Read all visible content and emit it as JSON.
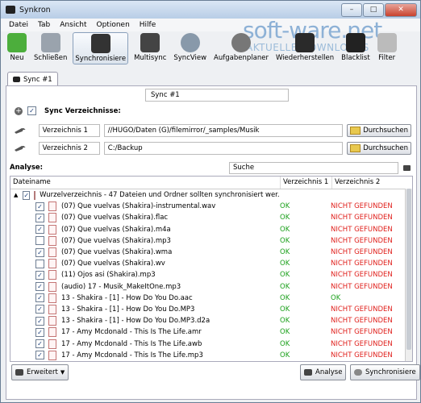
{
  "window": {
    "title": "Synkron",
    "controls": [
      "–",
      "□",
      "✕"
    ]
  },
  "watermark": {
    "main": "soft-ware.net",
    "sub": "AKTUELLE DOWNLOADS"
  },
  "menu": [
    "Datei",
    "Tab",
    "Ansicht",
    "Optionen",
    "Hilfe"
  ],
  "toolbar": [
    {
      "label": "Neu",
      "icon": "new-icon",
      "color": "#4cae3c"
    },
    {
      "label": "Schließen",
      "icon": "close-tab-icon",
      "color": "#9aa3ad"
    },
    {
      "label": "Synchronisiere",
      "icon": "sync-icon",
      "color": "#333333"
    },
    {
      "label": "Multisync",
      "icon": "multisync-icon",
      "color": "#444444"
    },
    {
      "label": "SyncView",
      "icon": "magnifier-icon",
      "color": "#8899aa"
    },
    {
      "label": "Aufgabenplaner",
      "icon": "alarm-clock-icon",
      "color": "#777777"
    },
    {
      "label": "Wiederherstellen",
      "icon": "restore-icon",
      "color": "#2a2a2a"
    },
    {
      "label": "Blacklist",
      "icon": "blacklist-icon",
      "color": "#222222"
    },
    {
      "label": "Filter",
      "icon": "filter-icon",
      "color": "#bbbbbb"
    }
  ],
  "tab": {
    "label": "Sync #1"
  },
  "sync_name": "Sync #1",
  "section": {
    "label": "Sync Verzeichnisse:"
  },
  "folders": [
    {
      "label": "Verzeichnis 1",
      "path": "//HUGO/Daten (G)/filemirror/_samples/Musik",
      "button": "Durchsuchen"
    },
    {
      "label": "Verzeichnis 2",
      "path": "C:/Backup",
      "button": "Durchsuchen"
    }
  ],
  "analyse": {
    "label": "Analyse:",
    "search_placeholder": "Suche"
  },
  "table": {
    "headers": [
      "Dateiname",
      "Verzeichnis 1",
      "Verzeichnis 2"
    ],
    "root": "Wurzelverzeichnis - 47 Dateien und Ordner sollten synchronisiert wer...",
    "rows": [
      {
        "name": "(07) Que vuelvas (Shakira)-instrumental.wav",
        "v1": "OK",
        "v2": "NICHT GEFUNDEN",
        "checked": true
      },
      {
        "name": "(07) Que vuelvas (Shakira).flac",
        "v1": "OK",
        "v2": "NICHT GEFUNDEN",
        "checked": true
      },
      {
        "name": "(07) Que vuelvas (Shakira).m4a",
        "v1": "OK",
        "v2": "NICHT GEFUNDEN",
        "checked": true
      },
      {
        "name": "(07) Que vuelvas (Shakira).mp3",
        "v1": "OK",
        "v2": "NICHT GEFUNDEN",
        "checked": false
      },
      {
        "name": "(07) Que vuelvas (Shakira).wma",
        "v1": "OK",
        "v2": "NICHT GEFUNDEN",
        "checked": true
      },
      {
        "name": "(07) Que vuelvas (Shakira).wv",
        "v1": "OK",
        "v2": "NICHT GEFUNDEN",
        "checked": false
      },
      {
        "name": "(11) Ojos asi (Shakira).mp3",
        "v1": "OK",
        "v2": "NICHT GEFUNDEN",
        "checked": true
      },
      {
        "name": "(audio) 17 - Musik_MakeItOne.mp3",
        "v1": "OK",
        "v2": "NICHT GEFUNDEN",
        "checked": true
      },
      {
        "name": "13 - Shakira - [1] - How Do You Do.aac",
        "v1": "OK",
        "v2": "OK",
        "checked": true
      },
      {
        "name": "13 - Shakira - [1] - How Do You Do.MP3",
        "v1": "OK",
        "v2": "NICHT GEFUNDEN",
        "checked": true
      },
      {
        "name": "13 - Shakira - [1] - How Do You Do.MP3.d2a",
        "v1": "OK",
        "v2": "NICHT GEFUNDEN",
        "checked": true
      },
      {
        "name": "17 - Amy Mcdonald - This Is The Life.amr",
        "v1": "OK",
        "v2": "NICHT GEFUNDEN",
        "checked": true
      },
      {
        "name": "17 - Amy Mcdonald - This Is The Life.awb",
        "v1": "OK",
        "v2": "NICHT GEFUNDEN",
        "checked": true
      },
      {
        "name": "17 - Amy Mcdonald - This Is The Life.mp3",
        "v1": "OK",
        "v2": "NICHT GEFUNDEN",
        "checked": true
      }
    ]
  },
  "bottom": {
    "advanced": "Erweitert",
    "analyse": "Analyse",
    "sync": "Synchronisiere"
  },
  "colors": {
    "ok": "#1aa01a",
    "not_found": "#e0201c"
  }
}
